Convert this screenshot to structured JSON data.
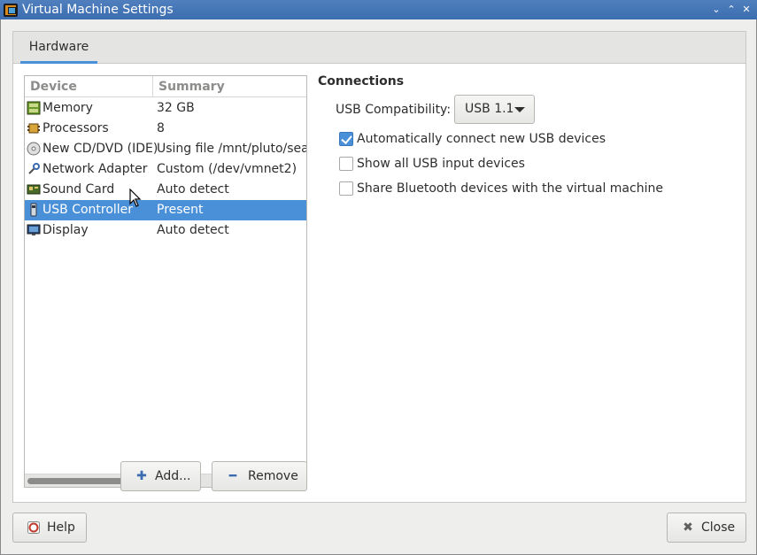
{
  "window": {
    "title": "Virtual Machine Settings",
    "controls": [
      "⌄",
      "⌃",
      "✕"
    ]
  },
  "tabs": [
    {
      "label": "Hardware",
      "active": true
    }
  ],
  "device_list": {
    "headers": {
      "device": "Device",
      "summary": "Summary"
    },
    "rows": [
      {
        "name": "Memory",
        "summary": "32 GB",
        "icon": "memory-icon",
        "selected": false
      },
      {
        "name": "Processors",
        "summary": "8",
        "icon": "processor-icon",
        "selected": false
      },
      {
        "name": "New CD/DVD (IDE)",
        "summary": "Using file /mnt/pluto/seaga",
        "icon": "cd-dvd-icon",
        "selected": false
      },
      {
        "name": "Network Adapter",
        "summary": "Custom (/dev/vmnet2)",
        "icon": "network-icon",
        "selected": false
      },
      {
        "name": "Sound Card",
        "summary": "Auto detect",
        "icon": "sound-card-icon",
        "selected": false
      },
      {
        "name": "USB Controller",
        "summary": "Present",
        "icon": "usb-icon",
        "selected": true
      },
      {
        "name": "Display",
        "summary": "Auto detect",
        "icon": "display-icon",
        "selected": false
      }
    ]
  },
  "list_buttons": {
    "add": "Add...",
    "remove": "Remove"
  },
  "connections": {
    "title": "Connections",
    "usb_compat_label": "USB Compatibility:",
    "usb_compat_value": "USB 1.1",
    "options": [
      {
        "label": "Automatically connect new USB devices",
        "checked": true
      },
      {
        "label": "Show all USB input devices",
        "checked": false
      },
      {
        "label": "Share Bluetooth devices with the virtual machine",
        "checked": false
      }
    ]
  },
  "footer": {
    "help": "Help",
    "close": "Close"
  },
  "colors": {
    "accent": "#4a90d9",
    "titlebar": "#3c6db0",
    "window_bg": "#eeeeec"
  }
}
